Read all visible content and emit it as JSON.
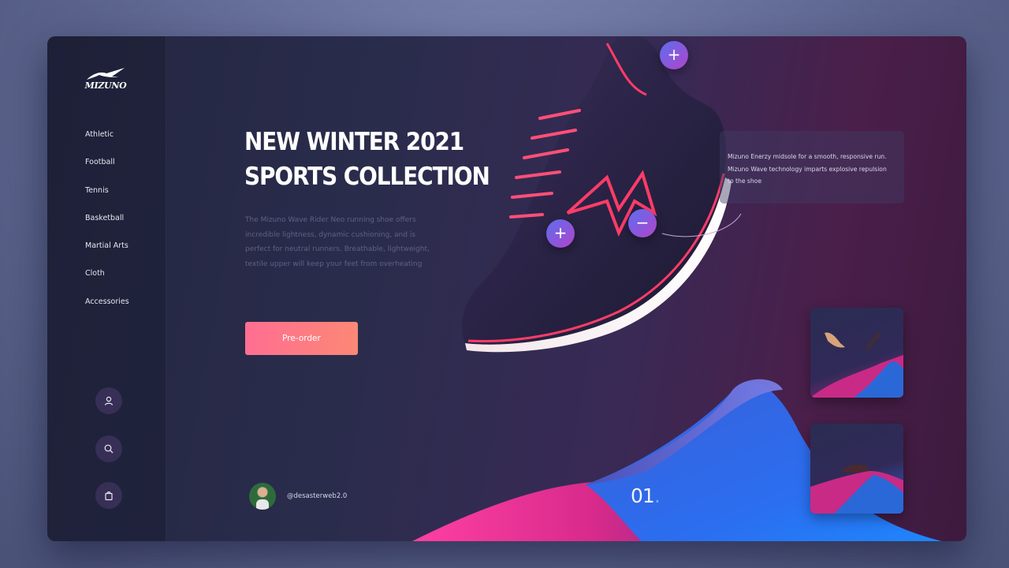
{
  "brand": {
    "logo_text": "MIZUNO"
  },
  "sidebar": {
    "items": [
      {
        "label": "Athletic"
      },
      {
        "label": "Football"
      },
      {
        "label": "Tennis"
      },
      {
        "label": "Basketball"
      },
      {
        "label": "Martial Arts"
      },
      {
        "label": "Cloth"
      },
      {
        "label": "Accessories"
      }
    ],
    "icons": [
      "user-icon",
      "search-icon",
      "bag-icon"
    ]
  },
  "hero": {
    "title_line1": "NEW WINTER 2021",
    "title_line2": "SPORTS COLLECTION",
    "description": "The Mizuno Wave Rider Neo running shoe offers incredible lightness, dynamic cushioning, and is perfect for neutral runners. Breathable, lightweight, textile upper will keep your feet from overheating",
    "cta_label": "Pre-order"
  },
  "hotspots": {
    "top": "+",
    "left": "+",
    "right": "−"
  },
  "feature_tooltip": {
    "text": "Mizuno Enerzy midsole for a smooth, responsive run. Mizuno Wave technology imparts explosive repulsion to the shoe"
  },
  "author": {
    "handle": "@desasterweb2.0"
  },
  "slide": {
    "number": "01",
    "dot": "."
  },
  "colors": {
    "accent_start": "#ff6e92",
    "accent_end": "#fb8875",
    "hotspot_start": "#5b6ef0",
    "hotspot_end": "#b244c9",
    "slide_dot": "#5bb4ff"
  }
}
